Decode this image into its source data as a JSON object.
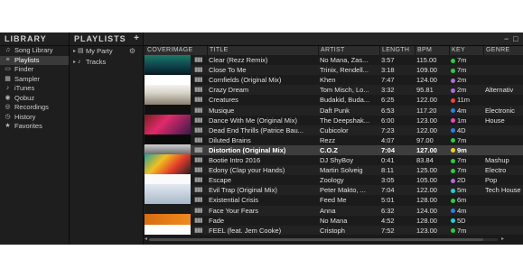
{
  "library": {
    "title": "LIBRARY",
    "items": [
      {
        "label": "Song Library",
        "icon": "music-library-icon",
        "glyph": "♫"
      },
      {
        "label": "Playlists",
        "icon": "playlist-icon",
        "glyph": "≡",
        "selected": true
      },
      {
        "label": "Finder",
        "icon": "folder-icon",
        "glyph": "▭"
      },
      {
        "label": "Sampler",
        "icon": "sampler-icon",
        "glyph": "▦"
      },
      {
        "label": "iTunes",
        "icon": "itunes-icon",
        "glyph": "♪"
      },
      {
        "label": "Qobuz",
        "icon": "qobuz-icon",
        "glyph": "◉"
      },
      {
        "label": "Recordings",
        "icon": "record-icon",
        "glyph": "◎"
      },
      {
        "label": "History",
        "icon": "history-icon",
        "glyph": "◷"
      },
      {
        "label": "Favorites",
        "icon": "star-icon",
        "glyph": "★"
      }
    ]
  },
  "playlists": {
    "title": "PLAYLISTS",
    "add_glyph": "+",
    "items": [
      {
        "label": "My Party",
        "glyph": "▤",
        "expand": "▸",
        "gear": "⚙"
      },
      {
        "label": "Tracks",
        "glyph": "♪",
        "expand": "▸"
      }
    ]
  },
  "window_controls": {
    "minimize": "−",
    "maximize": "□"
  },
  "columns": [
    "COVERIMAGE",
    "TITLE",
    "ARTIST",
    "LENGTH",
    "BPM",
    "KEY",
    "GENRE"
  ],
  "wave_glyph": "▮▮▮",
  "tracks": [
    {
      "title": "Clear (Rezz Remix)",
      "artist": "No Mana, Zas...",
      "length": "3:57",
      "bpm": "115.00",
      "key": "7m",
      "key_color": "#2ecc40",
      "genre": ""
    },
    {
      "title": "Close To Me",
      "artist": "Trinix, Rendell...",
      "length": "3:18",
      "bpm": "109.00",
      "key": "7m",
      "key_color": "#2ecc40",
      "genre": ""
    },
    {
      "title": "Cornfields (Original Mix)",
      "artist": "Khen",
      "length": "7:47",
      "bpm": "124.00",
      "key": "2m",
      "key_color": "#b06ad8",
      "genre": ""
    },
    {
      "title": "Crazy Dream",
      "artist": "Tom Misch, Lo...",
      "length": "3:32",
      "bpm": "95.81",
      "key": "2m",
      "key_color": "#b06ad8",
      "genre": "Alternativ"
    },
    {
      "title": "Creatures",
      "artist": "Budakid, Buda...",
      "length": "6:25",
      "bpm": "122.00",
      "key": "11m",
      "key_color": "#e8453c",
      "genre": ""
    },
    {
      "title": "Musique",
      "artist": "Daft Punk",
      "length": "6:53",
      "bpm": "117.20",
      "key": "4m",
      "key_color": "#2f7fe0",
      "genre": "Electronic"
    },
    {
      "title": "Dance With Me (Original Mix)",
      "artist": "The Deepshak...",
      "length": "6:00",
      "bpm": "123.00",
      "key": "1m",
      "key_color": "#e84ab2",
      "genre": "House"
    },
    {
      "title": "Dead End Thrills (Patrice Bau...",
      "artist": "Cubicolor",
      "length": "7:23",
      "bpm": "122.00",
      "key": "4D",
      "key_color": "#2f7fe0",
      "genre": ""
    },
    {
      "title": "Diluted Brains",
      "artist": "Rezz",
      "length": "4:07",
      "bpm": "97.00",
      "key": "7m",
      "key_color": "#2ecc40",
      "genre": ""
    },
    {
      "title": "Distortion (Original Mix)",
      "artist": "C.O.Z",
      "length": "7:04",
      "bpm": "127.00",
      "key": "9m",
      "key_color": "#f0d020",
      "genre": "",
      "selected": true
    },
    {
      "title": "Bootie Intro 2016",
      "artist": "DJ ShyBoy",
      "length": "0:41",
      "bpm": "83.84",
      "key": "7m",
      "key_color": "#2ecc40",
      "genre": "Mashup"
    },
    {
      "title": "Edony (Clap your Hands)",
      "artist": "Martin Solveig",
      "length": "8:11",
      "bpm": "125.00",
      "key": "7m",
      "key_color": "#2ecc40",
      "genre": "Electro"
    },
    {
      "title": "Escape",
      "artist": "Zoology",
      "length": "3:05",
      "bpm": "105.00",
      "key": "2D",
      "key_color": "#b06ad8",
      "genre": "Pop"
    },
    {
      "title": "Evil Trap (Original Mix)",
      "artist": "Peter Makto, ...",
      "length": "7:04",
      "bpm": "122.00",
      "key": "5m",
      "key_color": "#22d0d0",
      "genre": "Tech House"
    },
    {
      "title": "Existential Crisis",
      "artist": "Feed Me",
      "length": "5:01",
      "bpm": "128.00",
      "key": "6m",
      "key_color": "#2ecc40",
      "genre": ""
    },
    {
      "title": "Face Your Fears",
      "artist": "Anna",
      "length": "6:32",
      "bpm": "124.00",
      "key": "4m",
      "key_color": "#2f7fe0",
      "genre": ""
    },
    {
      "title": "Fade",
      "artist": "No Mana",
      "length": "4:52",
      "bpm": "128.00",
      "key": "5D",
      "key_color": "#22d0d0",
      "genre": ""
    },
    {
      "title": "FEEL (feat. Jem Cooke)",
      "artist": "Cristoph",
      "length": "7:52",
      "bpm": "123.00",
      "key": "7m",
      "key_color": "#2ecc40",
      "genre": ""
    }
  ],
  "scroll": {
    "left": "◂",
    "right": "▸"
  }
}
